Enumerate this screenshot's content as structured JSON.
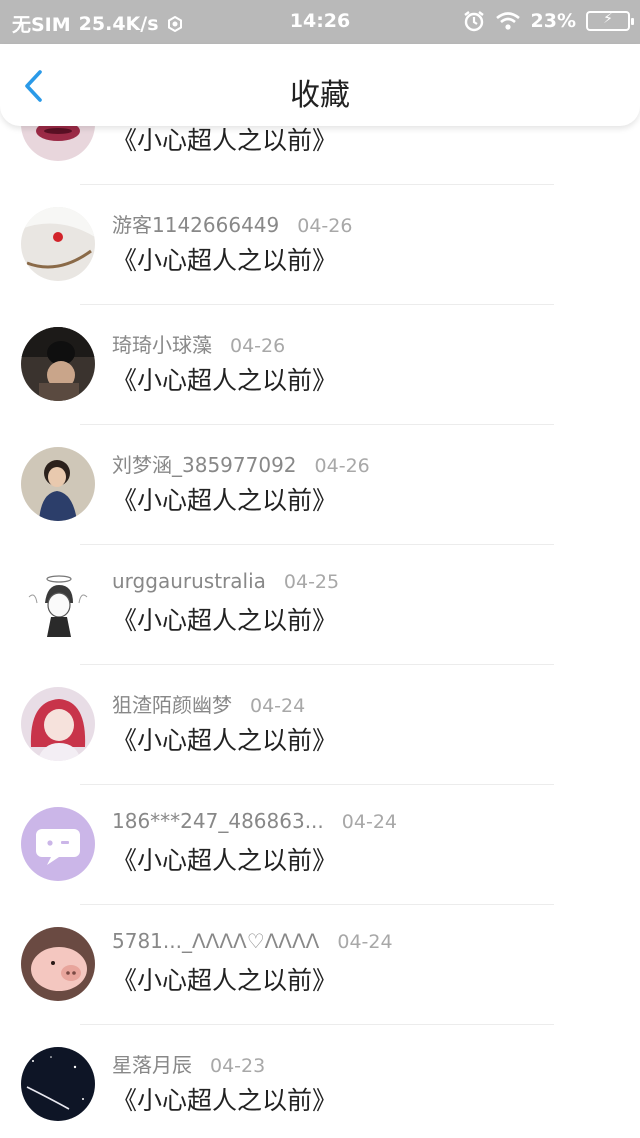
{
  "status_bar": {
    "carrier": "无SIM",
    "speed": "25.4K/s",
    "time": "14:26",
    "battery": "23%"
  },
  "header": {
    "title": "收藏",
    "back_icon": "chevron-left-icon",
    "accent_color": "#2a9ae8"
  },
  "items": [
    {
      "user": "",
      "date": "",
      "title": "《小心超人之以前》",
      "avatar": "lips-avatar"
    },
    {
      "user": "游客1142666449",
      "date": "04-26",
      "title": "《小心超人之以前》",
      "avatar": "bracelet-avatar"
    },
    {
      "user": "琦琦小球藻",
      "date": "04-26",
      "title": "《小心超人之以前》",
      "avatar": "hat-avatar"
    },
    {
      "user": "刘梦涵_385977092",
      "date": "04-26",
      "title": "《小心超人之以前》",
      "avatar": "girl-avatar"
    },
    {
      "user": "urggaurustralia",
      "date": "04-25",
      "title": "《小心超人之以前》",
      "avatar": "angel-sketch-avatar"
    },
    {
      "user": "狙渣陌颜幽梦",
      "date": "04-24",
      "title": "《小心超人之以前》",
      "avatar": "anime-girl-avatar"
    },
    {
      "user": "186***247_486863...",
      "date": "04-24",
      "title": "《小心超人之以前》",
      "avatar": "chat-bubble-avatar"
    },
    {
      "user": "5781..._ᐱᐱᐱᐱ♡ᐱᐱᐱᐱ",
      "date": "04-24",
      "title": "《小心超人之以前》",
      "avatar": "pig-avatar"
    },
    {
      "user": "星落月辰",
      "date": "04-23",
      "title": "《小心超人之以前》",
      "avatar": "night-sky-avatar"
    }
  ]
}
